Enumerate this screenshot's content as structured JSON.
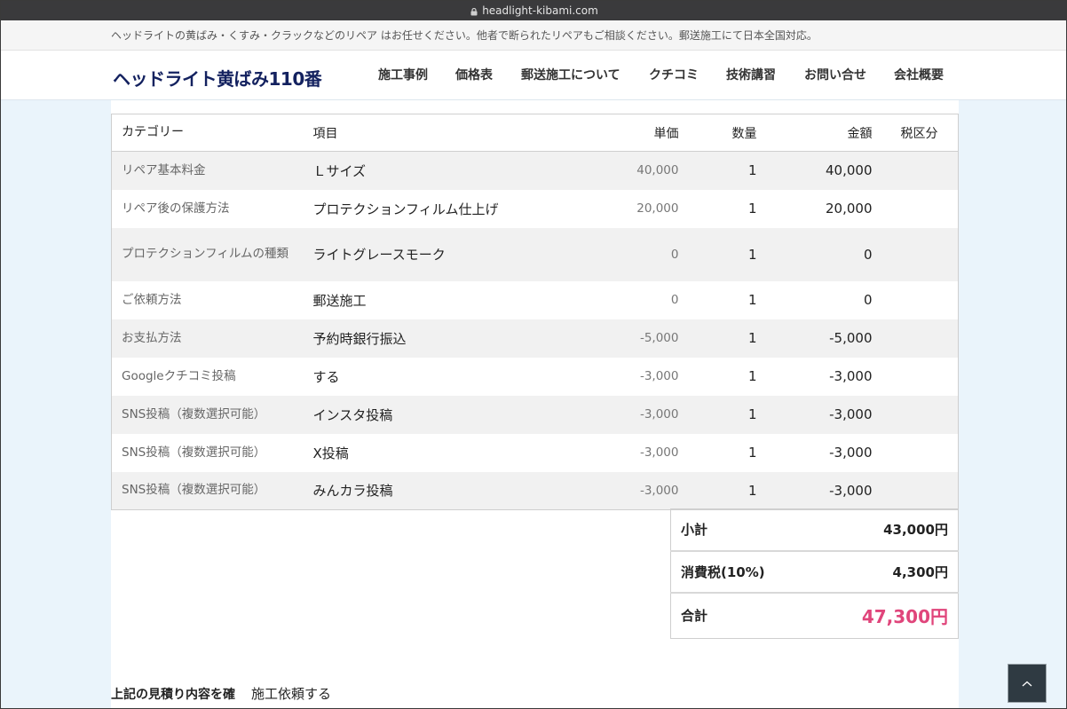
{
  "browser": {
    "url": "headlight-kibami.com"
  },
  "notice": {
    "text": "ヘッドライトの黄ばみ・くすみ・クラックなどのリペア はお任せください。他者で断られたリペアもご相談ください。郵送施工にて日本全国対応。"
  },
  "header": {
    "logo": "ヘッドライト黄ばみ110番",
    "nav": [
      "施工事例",
      "価格表",
      "郵送施工について",
      "クチコミ",
      "技術講習",
      "お問い合せ",
      "会社概要"
    ]
  },
  "estimate": {
    "columns": {
      "category": "カテゴリー",
      "item": "項目",
      "unit_price": "単価",
      "quantity": "数量",
      "amount": "金額",
      "tax": "税区分"
    },
    "rows": [
      {
        "category": "リペア基本料金",
        "item": "Ｌサイズ",
        "unit_price": "40,000",
        "quantity": "1",
        "amount": "40,000",
        "tax": ""
      },
      {
        "category": "リペア後の保護方法",
        "item": "プロテクションフィルム仕上げ",
        "unit_price": "20,000",
        "quantity": "1",
        "amount": "20,000",
        "tax": ""
      },
      {
        "category": "プロテクションフィルムの種類",
        "item": "ライトグレースモーク",
        "unit_price": "0",
        "quantity": "1",
        "amount": "0",
        "tax": ""
      },
      {
        "category": "ご依頼方法",
        "item": "郵送施工",
        "unit_price": "0",
        "quantity": "1",
        "amount": "0",
        "tax": ""
      },
      {
        "category": "お支払方法",
        "item": "予約時銀行振込",
        "unit_price": "-5,000",
        "quantity": "1",
        "amount": "-5,000",
        "tax": ""
      },
      {
        "category": "Googleクチコミ投稿",
        "item": "する",
        "unit_price": "-3,000",
        "quantity": "1",
        "amount": "-3,000",
        "tax": ""
      },
      {
        "category": "SNS投稿（複数選択可能）",
        "item": "インスタ投稿",
        "unit_price": "-3,000",
        "quantity": "1",
        "amount": "-3,000",
        "tax": ""
      },
      {
        "category": "SNS投稿（複数選択可能）",
        "item": "X投稿",
        "unit_price": "-3,000",
        "quantity": "1",
        "amount": "-3,000",
        "tax": ""
      },
      {
        "category": "SNS投稿（複数選択可能）",
        "item": "みんカラ投稿",
        "unit_price": "-3,000",
        "quantity": "1",
        "amount": "-3,000",
        "tax": ""
      }
    ]
  },
  "totals": {
    "subtotal_label": "小計",
    "subtotal_value": "43,000円",
    "tax_label": "消費税(10%)",
    "tax_value": "4,300円",
    "total_label": "合計",
    "total_value": "47,300円",
    "total_color": "#e0457b"
  },
  "confirm": {
    "text": "上記の見積り内容を確",
    "request_label": "施工依頼する"
  },
  "icons": {
    "lock": "lock-icon",
    "back_to_top": "chevron-up-icon"
  }
}
